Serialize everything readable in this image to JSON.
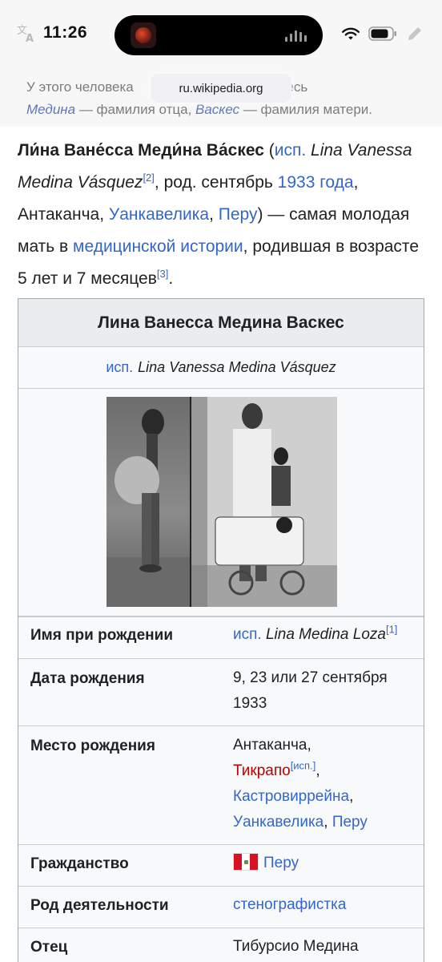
{
  "status_bar": {
    "time": "11:26"
  },
  "browser": {
    "url": "ru.wikipedia.org"
  },
  "note": {
    "part1": "У этого человека ",
    "part2": "я; здесь",
    "link1": "Медина",
    "mid": " — фамилия отца, ",
    "link2": "Васкес",
    "end": " — фамилия матери."
  },
  "intro": {
    "name": "Ли́на Ване́сса Меди́на Ва́скес",
    "open_paren": " (",
    "lang_link": "исп.",
    "name_latin": "Lina Vanessa Medina Vásquez",
    "ref2": "[2]",
    "born": ", род. сентябрь ",
    "year_link": "1933 года",
    "comma1": ", Антаканча, ",
    "region_link": "Уанкавелика",
    "comma2": ", ",
    "country_link": "Перу",
    "rest": ") — самая молодая мать в ",
    "med_link": "медицинской истории",
    "rest2": ", родившая в возрасте 5 лет и 7 месяцев",
    "ref3": "[3]",
    "period": "."
  },
  "infobox": {
    "title": "Лина Ванесса Медина Васкес",
    "subtitle_lang": "исп.",
    "subtitle_name": "Lina Vanessa Medina Vásquez",
    "rows": {
      "birth_name": {
        "label": "Имя при рождении",
        "lang": "исп.",
        "value": "Lina Medina Loza",
        "ref": "[1]"
      },
      "birth_date": {
        "label": "Дата рождения",
        "value": "9, 23 или 27 сентября 1933"
      },
      "birth_place": {
        "label": "Место рождения",
        "v1": "Антаканча,",
        "v2": "Тикрапо",
        "v2_ref": "[исп.]",
        "v2_comma": ",",
        "v3": "Кастровиррейна",
        "v3_comma": ",",
        "v4": "Уанкавелика",
        "v4_comma": ", ",
        "v5": "Перу"
      },
      "citizenship": {
        "label": "Гражданство",
        "value": "Перу"
      },
      "occupation": {
        "label": "Род деятельности",
        "value": "стенографистка"
      },
      "father": {
        "label": "Отец",
        "value": "Тибурсио Медина"
      }
    }
  },
  "colors": {
    "link": "#3366cc",
    "redlink": "#ba0000",
    "infobox_bg": "#f8f9fa",
    "infobox_title_bg": "#eaecf0"
  }
}
